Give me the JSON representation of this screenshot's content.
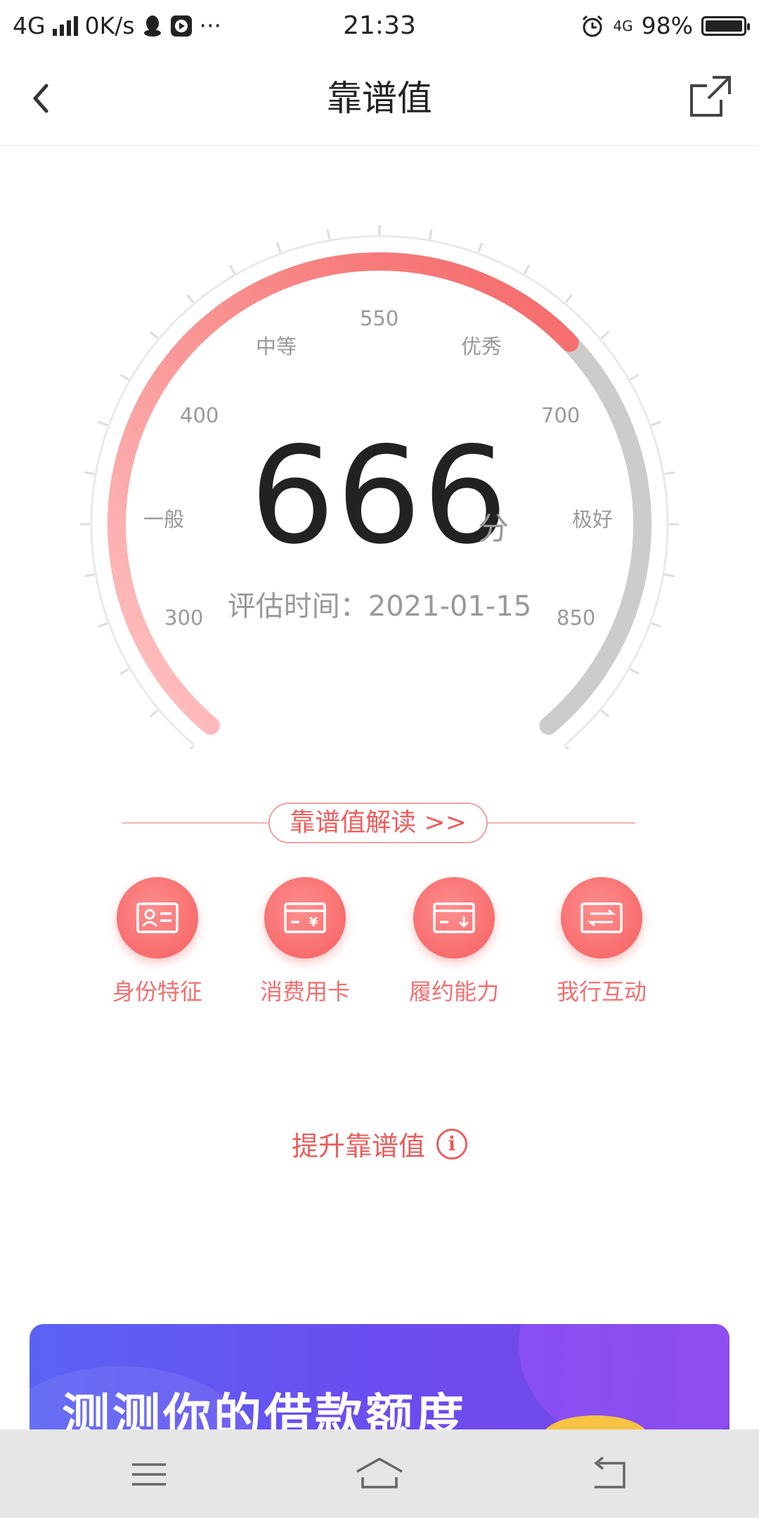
{
  "status_bar": {
    "network": "4G",
    "speed": "0K/s",
    "time": "21:33",
    "network_right": "4G",
    "battery": "98%"
  },
  "header": {
    "title": "靠谱值"
  },
  "gauge": {
    "score": "666",
    "unit": "分",
    "eval_label": "评估时间：",
    "eval_date": "2021-01-15",
    "min": 300,
    "max": 850,
    "value": 666,
    "tick_labels": [
      "300",
      "400",
      "550",
      "700",
      "850"
    ],
    "grade_labels": [
      "一般",
      "中等",
      "优秀",
      "极好"
    ],
    "colors": {
      "start": "#ffc4c4",
      "end": "#f56767",
      "rest": "#cccccc"
    }
  },
  "interpretation": {
    "button_label": "靠谱值解读 >>"
  },
  "features": [
    {
      "label": "身份特征",
      "icon": "id-card-icon"
    },
    {
      "label": "消费用卡",
      "icon": "yuan-card-icon"
    },
    {
      "label": "履约能力",
      "icon": "contract-card-icon"
    },
    {
      "label": "我行互动",
      "icon": "exchange-icon"
    }
  ],
  "improve": {
    "label": "提升靠谱值"
  },
  "banner": {
    "title": "测测你的借款额度"
  }
}
